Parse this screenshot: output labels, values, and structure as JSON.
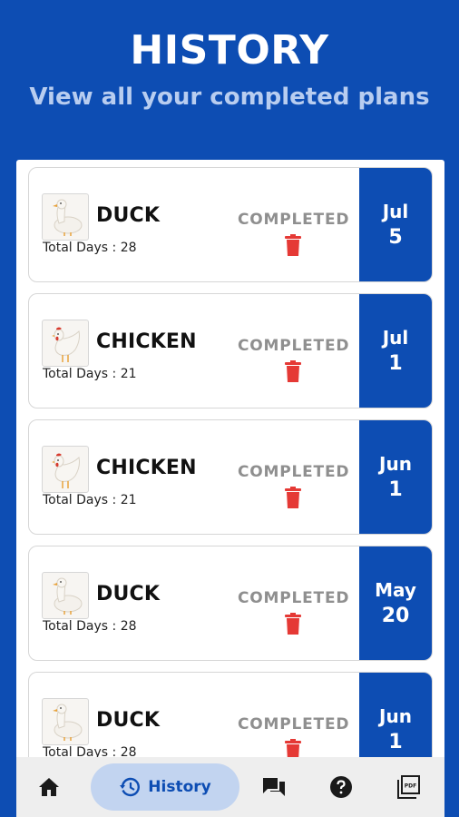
{
  "header": {
    "title": "HISTORY",
    "subtitle": "View all your completed plans"
  },
  "plans": [
    {
      "animal": "DUCK",
      "icon": "duck-icon",
      "total_days": "Total Days : 28",
      "status": "COMPLETED",
      "month": "Jul",
      "day": "5"
    },
    {
      "animal": "CHICKEN",
      "icon": "chicken-icon",
      "total_days": "Total Days : 21",
      "status": "COMPLETED",
      "month": "Jul",
      "day": "1"
    },
    {
      "animal": "CHICKEN",
      "icon": "chicken-icon",
      "total_days": "Total Days : 21",
      "status": "COMPLETED",
      "month": "Jun",
      "day": "1"
    },
    {
      "animal": "DUCK",
      "icon": "duck-icon",
      "total_days": "Total Days : 28",
      "status": "COMPLETED",
      "month": "May",
      "day": "20"
    },
    {
      "animal": "DUCK",
      "icon": "duck-icon",
      "total_days": "Total Days : 28",
      "status": "COMPLETED",
      "month": "Jun",
      "day": "1"
    }
  ],
  "bottom_nav": {
    "items": [
      {
        "icon": "home-icon"
      },
      {
        "icon": "history-icon",
        "label": "History",
        "active": true
      },
      {
        "icon": "chat-icon"
      },
      {
        "icon": "help-icon"
      },
      {
        "icon": "pdf-icon"
      }
    ]
  },
  "colors": {
    "primary": "#0d4db3",
    "delete": "#e53935",
    "status_text": "#8f8f8f",
    "nav_active_bg": "#c2d4f0"
  }
}
